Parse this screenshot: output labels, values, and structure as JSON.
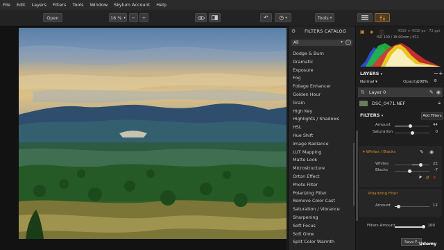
{
  "menu": [
    "File",
    "Edit",
    "Layers",
    "Filters",
    "Tools",
    "Window",
    "Skylum Account",
    "Help"
  ],
  "toolbar": {
    "open_label": "Open",
    "zoom_label": "16 %",
    "zoom_minus": "−",
    "zoom_plus": "+",
    "tools_label": "Tools"
  },
  "catalog": {
    "title": "FILTERS CATALOG",
    "selected_group": "All",
    "filters": [
      "Dodge & Burn",
      "Dramatic",
      "Exposure",
      "Fog",
      "Foliage Enhancer",
      "Golden Hour",
      "Grain",
      "High Key",
      "Highlights / Shadows",
      "HSL",
      "Hue Shift",
      "Image Radiance",
      "LUT Mapping",
      "Matte Look",
      "Microstructure",
      "Orton Effect",
      "Photo Filter",
      "Polarizing Filter",
      "Remove Color Cast",
      "Saturation / Vibrance",
      "Sharpening",
      "Soft Focus",
      "Soft Glow",
      "Split Color Warmth"
    ]
  },
  "histogram": {
    "info": "4016 × 4016 px · 72 ppi",
    "exif": "ISO 100 / 18.00mm / f/11"
  },
  "layers": {
    "title": "LAYERS",
    "blend_mode": "Normal",
    "opacity_label": "Opacity:",
    "opacity_value": "100%",
    "layer0": "Layer 0",
    "file": "DSC_0471.NEF"
  },
  "filters_panel": {
    "title": "FILTERS",
    "add_label": "Add Filters",
    "top": {
      "amount_label": "Amount",
      "amount_value": "44",
      "saturation_label": "Saturation",
      "saturation_value": "0"
    },
    "whites_blacks": {
      "name": "Whites / Blacks",
      "whites_label": "Whites",
      "whites_value": "22",
      "blacks_label": "Blacks",
      "blacks_value": "-7"
    },
    "polarizing": {
      "name": "Polarizing Filter",
      "amount_label": "Amount",
      "amount_value": "12"
    },
    "filters_amount_label": "Filters Amount",
    "filters_amount_value": "100"
  },
  "save_label": "Save F...",
  "watermark": "Udemy",
  "colors": {
    "accent": "#e08a2a",
    "close": "#d0302a"
  }
}
